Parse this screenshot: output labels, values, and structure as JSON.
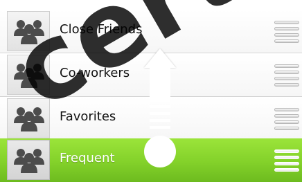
{
  "list": {
    "rows": [
      {
        "label": "Close Friends",
        "icon": "people-group-icon",
        "selected": false
      },
      {
        "label": "Co-workers",
        "icon": "people-group-icon",
        "selected": false
      },
      {
        "label": "Favorites",
        "icon": "people-group-icon",
        "selected": false
      },
      {
        "label": "Frequent",
        "icon": "people-group-icon",
        "selected": true
      }
    ],
    "selected_color": "#83d12a"
  },
  "gesture": {
    "direction": "up",
    "icon": "swipe-up-arrow-icon"
  },
  "watermark": {
    "text": "certified"
  }
}
